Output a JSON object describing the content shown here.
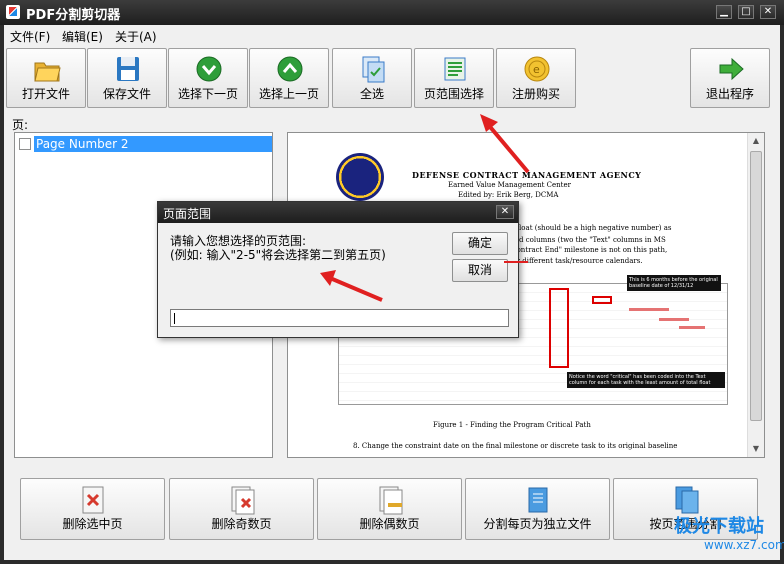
{
  "window": {
    "title": "PDF分割剪切器",
    "controls": {
      "minimize": "▁",
      "maximize": "□",
      "close": "✕"
    }
  },
  "menu": [
    "文件(F)",
    "编辑(E)",
    "关于(A)"
  ],
  "toolbar": [
    {
      "label": "打开文件",
      "icon": "folder-open-icon"
    },
    {
      "label": "保存文件",
      "icon": "floppy-disk-icon"
    },
    {
      "label": "选择下一页",
      "icon": "arrow-down-green-icon"
    },
    {
      "label": "选择上一页",
      "icon": "arrow-up-green-icon"
    },
    {
      "label": "全选",
      "icon": "select-all-pages-icon"
    },
    {
      "label": "页范围选择",
      "icon": "page-range-icon"
    },
    {
      "label": "注册购买",
      "icon": "coin-icon"
    },
    {
      "label": "退出程序",
      "icon": "exit-arrow-icon"
    }
  ],
  "pages_label": "页:",
  "page_list": [
    {
      "label": "Page Number 2",
      "checked": false,
      "selected": true
    }
  ],
  "preview": {
    "header1": "DEFENSE CONTRACT MANAGEMENT AGENCY",
    "header2": "Earned Value Management Center",
    "header3": "Edited by: Erik Berg, DCMA",
    "para": [
      "al float (should be a high negative number) as",
      "ified columns (two the \"Text\" columns in MS",
      "\"Contract End\" milestone is not on this path,",
      ", or different task/resource calendars."
    ],
    "callout_top": "This is 6 months before the original baseline date of 12/31/12",
    "callout_bottom": "Notice the word \"critical\" has been coded into the Text column for each task with the least amount of total float",
    "caption": "Figure 1 - Finding the Program Critical Path",
    "bottom_line": "8. Change the constraint date on the final milestone or discrete task to its original baseline"
  },
  "bottom_buttons": [
    {
      "label": "删除选中页",
      "icon": "delete-selected-page-icon"
    },
    {
      "label": "删除奇数页",
      "icon": "delete-odd-pages-icon"
    },
    {
      "label": "删除偶数页",
      "icon": "delete-even-pages-icon"
    },
    {
      "label": "分割每页为独立文件",
      "icon": "split-pages-icon"
    },
    {
      "label": "按页范围分割",
      "icon": "split-by-range-icon"
    }
  ],
  "dialog": {
    "title": "页面范围",
    "close": "✕",
    "prompt_line1": "请输入您想选择的页范围:",
    "prompt_line2": "(例如: 输入\"2-5\"将会选择第二到第五页)",
    "ok": "确定",
    "cancel": "取消",
    "input_value": ""
  },
  "watermark": {
    "main": "极光下载站",
    "url": "www.xz7.com"
  },
  "colors": {
    "accent_red": "#e02020",
    "selection": "#3399ff",
    "green_icon": "#2e9e3a"
  }
}
